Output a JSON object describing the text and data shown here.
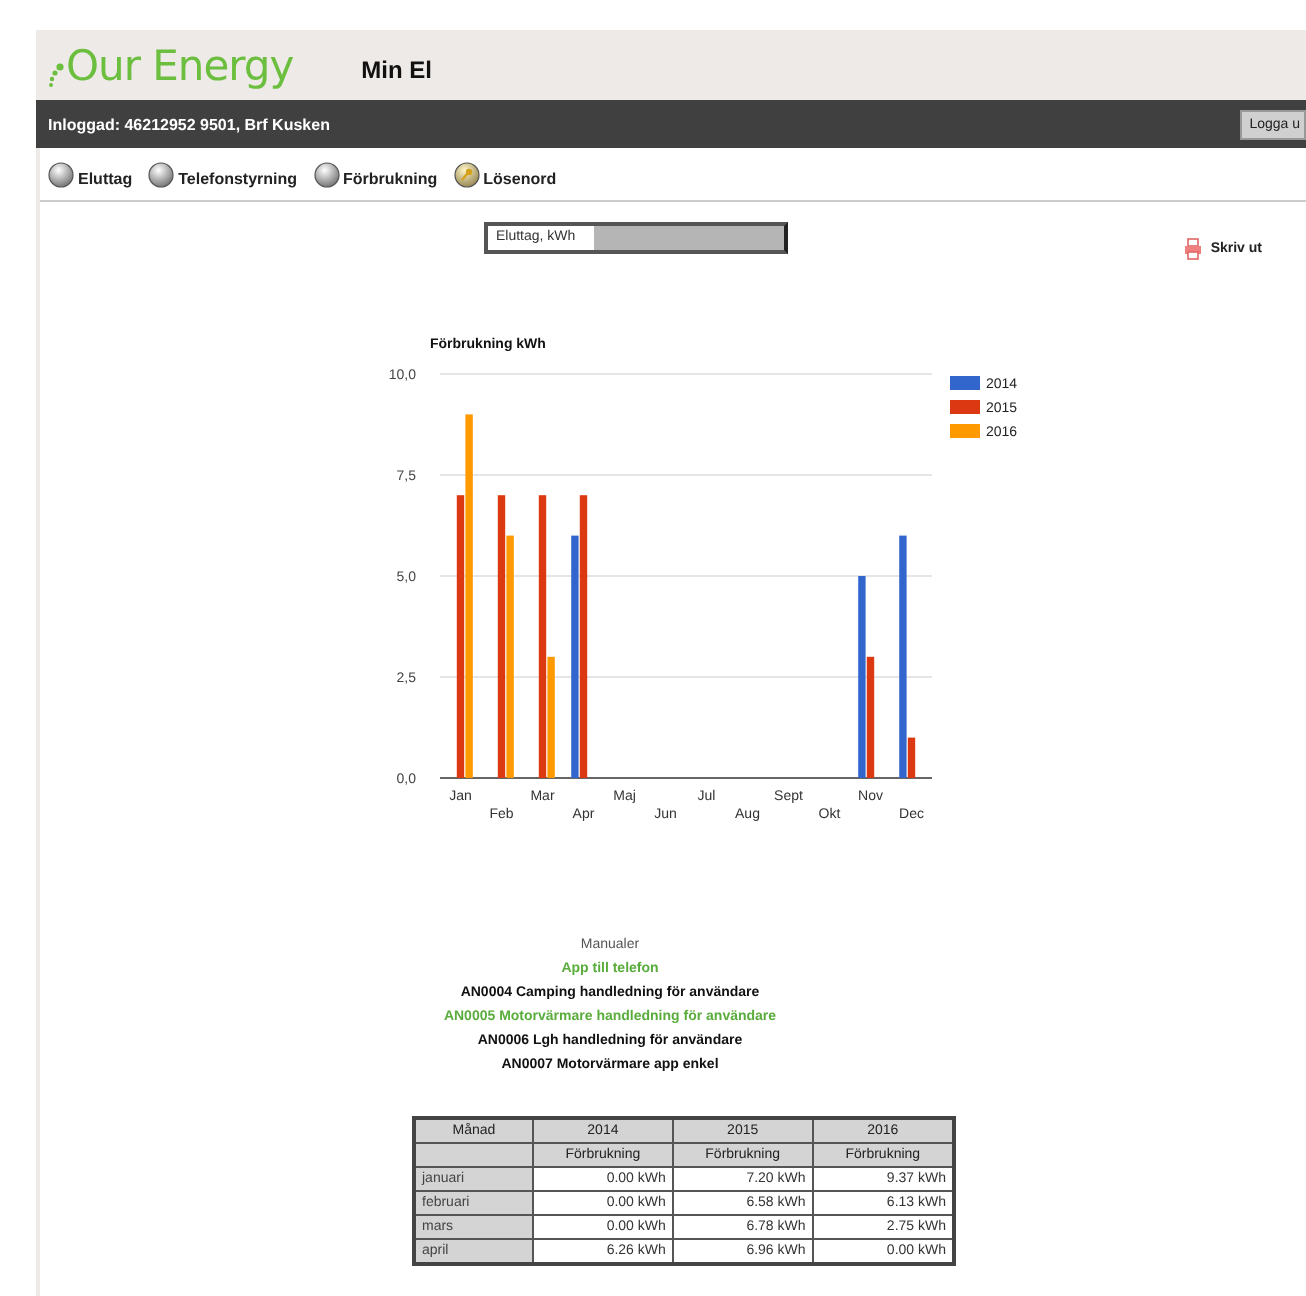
{
  "header": {
    "logo": "Our Energy",
    "title": "Min El"
  },
  "user_bar": {
    "text": "Inloggad: 46212952 9501, Brf Kusken",
    "button": "Logga u"
  },
  "nav": [
    {
      "label": "Eluttag",
      "kind": "plain"
    },
    {
      "label": "Telefonstyrning",
      "kind": "plain"
    },
    {
      "label": "Förbrukning",
      "kind": "plain"
    },
    {
      "label": "Lösenord",
      "kind": "key"
    }
  ],
  "selector": {
    "value": "Eluttag,  kWh"
  },
  "print": {
    "label": "Skriv ut"
  },
  "chart": {
    "chart_data": {
      "type": "bar",
      "title": "Förbrukning kWh",
      "categories": [
        "Jan",
        "Feb",
        "Mar",
        "Apr",
        "Maj",
        "Jun",
        "Jul",
        "Aug",
        "Sept",
        "Okt",
        "Nov",
        "Dec"
      ],
      "series": [
        {
          "name": "2014",
          "color": "#3366cc",
          "values": [
            0,
            0,
            0,
            6,
            0,
            0,
            0,
            0,
            0,
            0,
            5,
            6
          ]
        },
        {
          "name": "2015",
          "color": "#dc3912",
          "values": [
            7,
            7,
            7,
            7,
            0,
            0,
            0,
            0,
            0,
            0,
            3,
            1
          ]
        },
        {
          "name": "2016",
          "color": "#ff9900",
          "values": [
            9,
            6,
            3,
            0,
            0,
            0,
            0,
            0,
            0,
            0,
            0,
            0
          ]
        }
      ],
      "grid": true,
      "legend": "right",
      "ylim": [
        0,
        10
      ],
      "yticks": [
        {
          "value": 0,
          "label": "0,0"
        },
        {
          "value": 2.5,
          "label": "2,5"
        },
        {
          "value": 5,
          "label": "5,0"
        },
        {
          "value": 7.5,
          "label": "7,5"
        },
        {
          "value": 10,
          "label": "10,0"
        }
      ]
    }
  },
  "manuals": {
    "heading": "Manualer",
    "links": [
      {
        "label": "App till telefon",
        "color": "#5aad3c"
      },
      {
        "label": "AN0004 Camping handledning för användare",
        "color": "#111111"
      },
      {
        "label": "AN0005 Motorvärmare handledning för användare",
        "color": "#5aad3c"
      },
      {
        "label": "AN0006 Lgh handledning för användare",
        "color": "#111111"
      },
      {
        "label": "AN0007 Motorvärmare app enkel",
        "color": "#111111"
      }
    ]
  },
  "table": {
    "columns": [
      "Månad",
      "2014",
      "2015",
      "2016"
    ],
    "subheaders": [
      "Förbrukning",
      "Förbrukning",
      "Förbrukning"
    ],
    "rows": [
      [
        "januari",
        "0.00 kWh",
        "7.20 kWh",
        "9.37 kWh"
      ],
      [
        "februari",
        "0.00 kWh",
        "6.58 kWh",
        "6.13 kWh"
      ],
      [
        "mars",
        "0.00 kWh",
        "6.78 kWh",
        "2.75 kWh"
      ],
      [
        "april",
        "6.26 kWh",
        "6.96 kWh",
        "0.00 kWh"
      ]
    ]
  }
}
